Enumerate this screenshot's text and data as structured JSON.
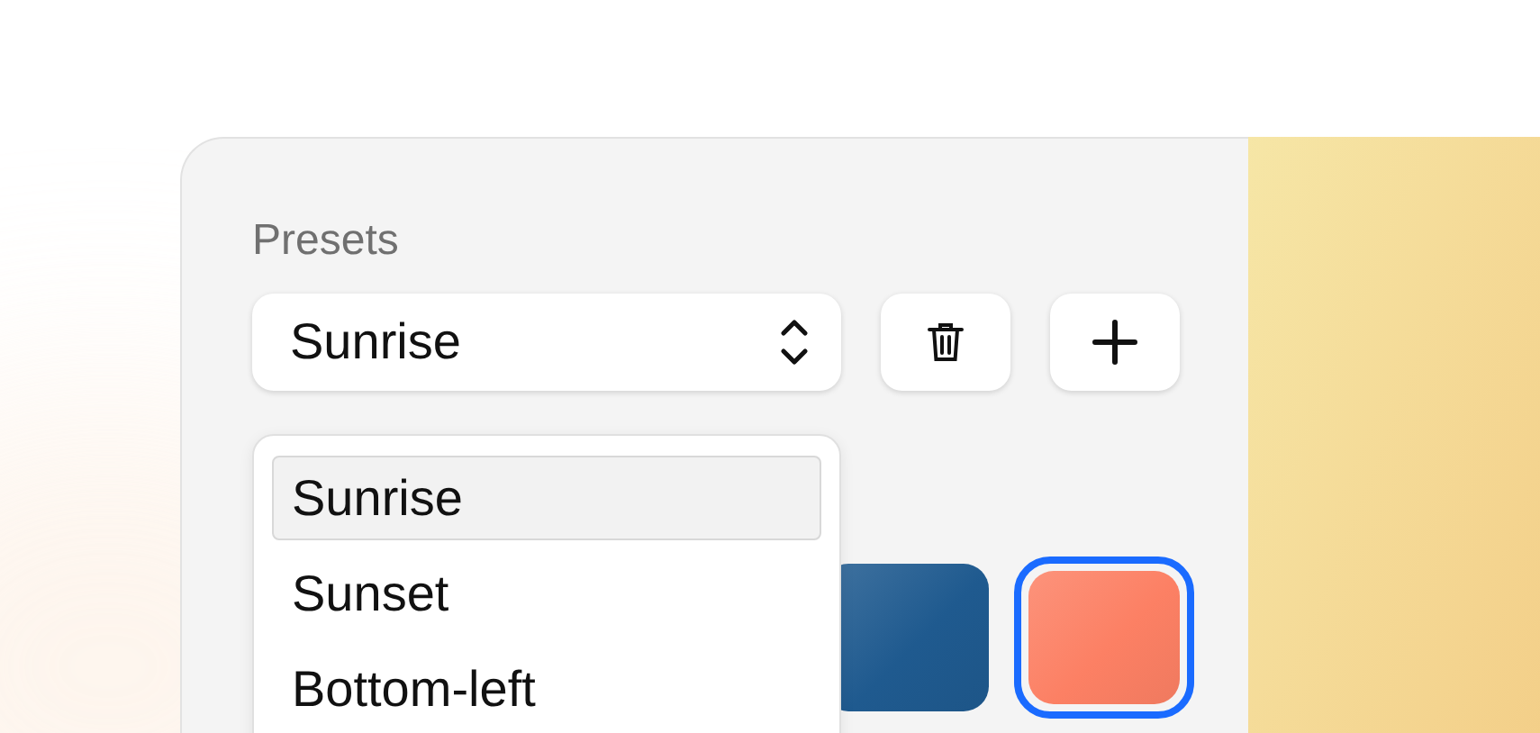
{
  "presets": {
    "label": "Presets",
    "value": "Sunrise"
  },
  "menu": {
    "items": [
      {
        "label": "Sunrise",
        "selected": true
      },
      {
        "label": "Sunset",
        "selected": false
      },
      {
        "label": "Bottom-left",
        "selected": false
      }
    ]
  },
  "swatches": [
    {
      "color": "#1f5a8f",
      "selected": false
    },
    {
      "color": "#fc8064",
      "selected": true
    }
  ]
}
